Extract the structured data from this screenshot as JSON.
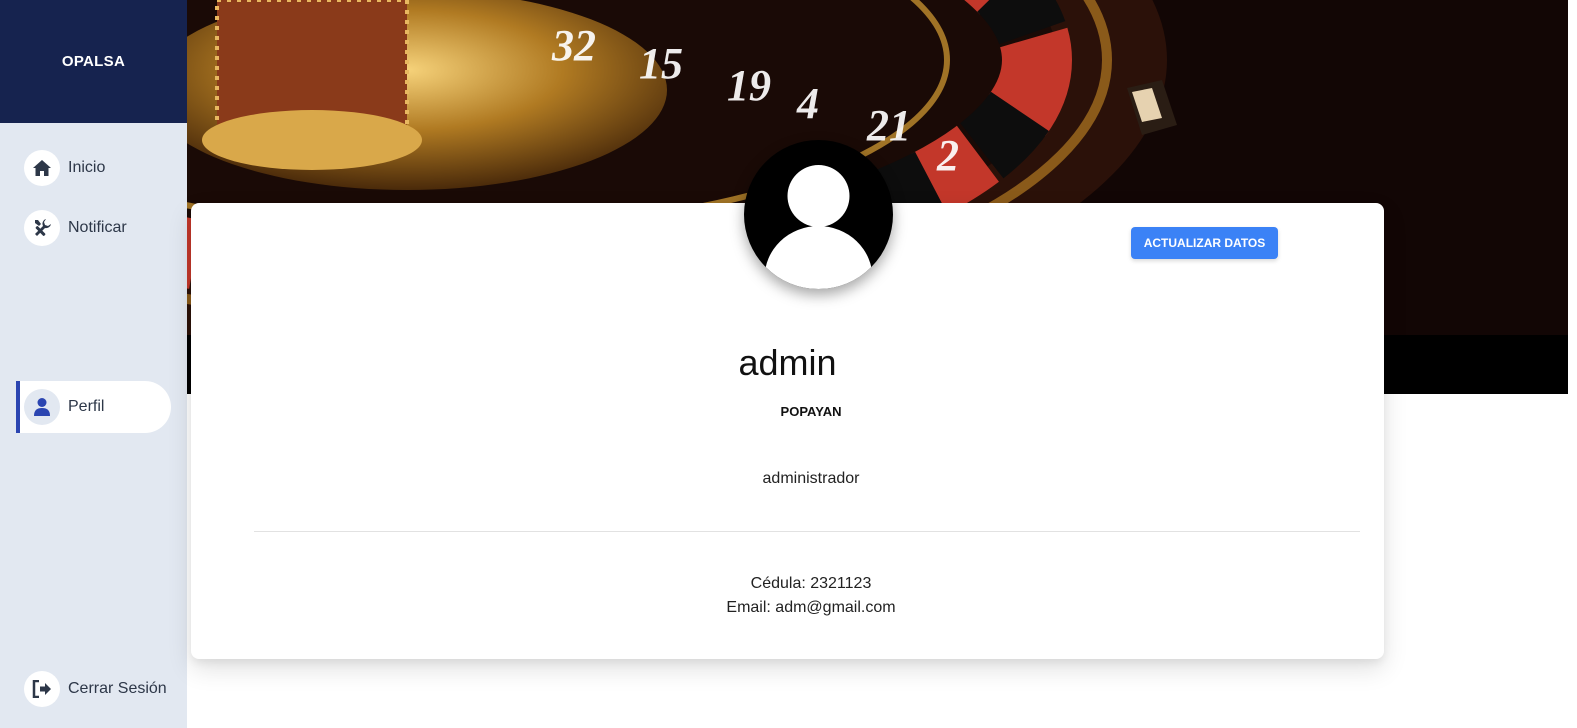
{
  "brand": {
    "name": "OPALSA"
  },
  "sidebar": {
    "items": [
      {
        "label": "Inicio",
        "icon": "home-icon"
      },
      {
        "label": "Notificar",
        "icon": "tools-icon"
      },
      {
        "label": "Perfil",
        "icon": "user-icon",
        "active": true
      }
    ],
    "logout": {
      "label": "Cerrar Sesión",
      "icon": "sign-out-icon"
    }
  },
  "banner": {
    "image": "roulette-wheel-photo",
    "numbers": [
      "32",
      "15",
      "19",
      "4",
      "21",
      "2"
    ]
  },
  "profile": {
    "avatar_icon": "user-avatar-icon",
    "update_button": "ACTUALIZAR DATOS",
    "name": "admin",
    "city": "POPAYAN",
    "role": "administrador",
    "cedula": "Cédula: 2321123",
    "email": "Email: adm@gmail.com"
  },
  "colors": {
    "brand_bg": "#16234f",
    "sidebar_bg": "#e2e8f1",
    "accent": "#2b45b1",
    "button": "#3b82f6"
  }
}
